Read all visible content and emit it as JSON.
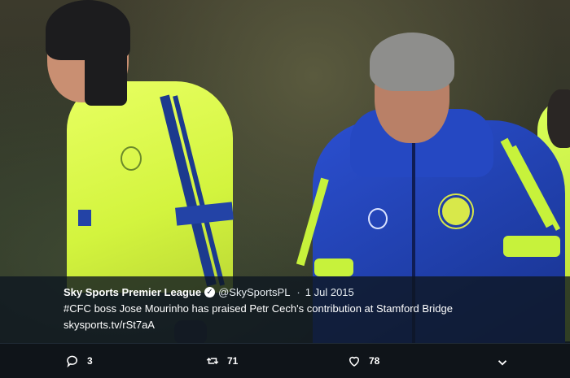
{
  "tweet": {
    "author_name": "Sky Sports Premier League",
    "handle": "@SkySportsPL",
    "separator": "·",
    "date": "1 Jul 2015",
    "hashtag": "#CFC",
    "text": " boss Jose Mourinho has praised Petr Cech's contribution at Stamford Bridge",
    "link": "skysports.tv/rSt7aA",
    "verified_icon": "verified-badge-icon"
  },
  "actions": {
    "reply_count": "3",
    "retweet_count": "71",
    "like_count": "78",
    "reply_icon": "reply-bubble-icon",
    "retweet_icon": "retweet-icon",
    "like_icon": "heart-icon",
    "more_icon": "chevron-down-icon"
  },
  "photo": {
    "subject": "training-photo"
  },
  "colors": {
    "background": "#0f1419",
    "overlay": "#0e1620",
    "text": "#ffffff"
  }
}
